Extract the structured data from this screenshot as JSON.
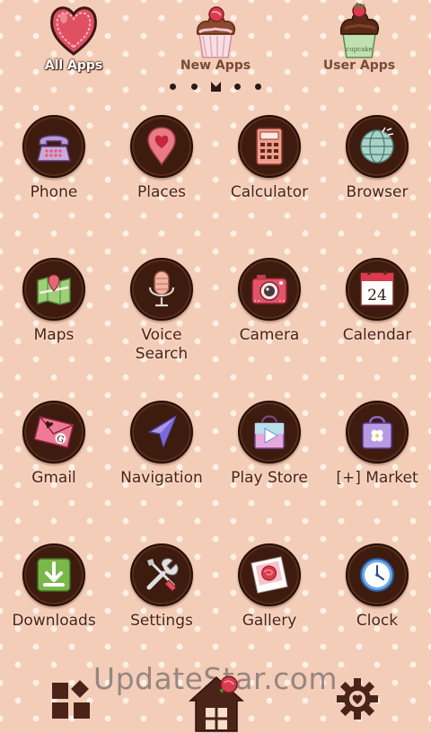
{
  "tabs": [
    {
      "label": "All Apps",
      "icon": "heart-icon",
      "active": true
    },
    {
      "label": "New Apps",
      "icon": "cupcake-pink-icon",
      "active": false
    },
    {
      "label": "User Apps",
      "icon": "cupcake-chocolate-icon",
      "active": false
    }
  ],
  "pager": {
    "pages": 5,
    "current_page": 3
  },
  "apps": [
    {
      "label": "Phone",
      "icon": "telephone-icon"
    },
    {
      "label": "Places",
      "icon": "map-pin-heart-icon"
    },
    {
      "label": "Calculator",
      "icon": "calculator-icon"
    },
    {
      "label": "Browser",
      "icon": "globe-icon"
    },
    {
      "label": "Maps",
      "icon": "map-icon"
    },
    {
      "label": "Voice\nSearch",
      "icon": "microphone-icon"
    },
    {
      "label": "Camera",
      "icon": "camera-icon"
    },
    {
      "label": "Calendar",
      "icon": "calendar-icon"
    },
    {
      "label": "Gmail",
      "icon": "envelope-icon"
    },
    {
      "label": "Navigation",
      "icon": "navigation-arrow-icon"
    },
    {
      "label": "Play Store",
      "icon": "shopping-bag-play-icon"
    },
    {
      "label": "[+] Market",
      "icon": "shopping-bag-icon"
    },
    {
      "label": "Downloads",
      "icon": "download-icon"
    },
    {
      "label": "Settings",
      "icon": "tools-icon"
    },
    {
      "label": "Gallery",
      "icon": "photo-rose-icon"
    },
    {
      "label": "Clock",
      "icon": "clock-icon"
    }
  ],
  "calendar_day": "24",
  "dock": {
    "left": "widgets-icon",
    "center": "house-rose-icon",
    "right": "gear-heart-icon"
  },
  "watermark": "UpdateStar.com",
  "colors": {
    "background": "#f3cdb8",
    "polka_dot": "#fbf1e6",
    "icon_ring": "#3d1c0f",
    "label": "#4a2418"
  }
}
